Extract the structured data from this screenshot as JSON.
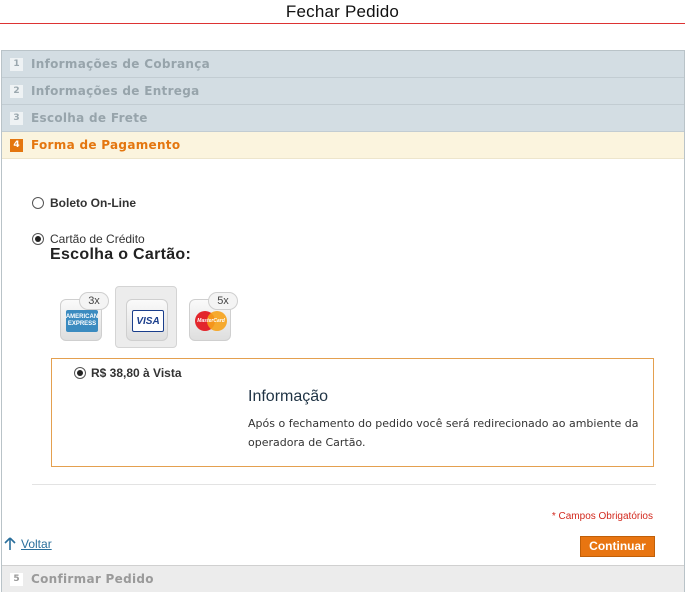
{
  "header": {
    "title": "Fechar Pedido"
  },
  "steps": [
    {
      "num": "1",
      "label": "Informações de Cobrança"
    },
    {
      "num": "2",
      "label": "Informações de Entrega"
    },
    {
      "num": "3",
      "label": "Escolha de Frete"
    },
    {
      "num": "4",
      "label": "Forma de Pagamento"
    },
    {
      "num": "5",
      "label": "Confirmar Pedido"
    }
  ],
  "payment": {
    "options": [
      {
        "label": "Boleto On-Line",
        "selected": false
      },
      {
        "label": "Cartão de Crédito",
        "selected": true
      }
    ],
    "choose_card_title": "Escolha o Cartão:",
    "cards": [
      {
        "name": "amex-card-icon",
        "logo_text": "AMERICAN EXPRESS",
        "installments_badge": "3x",
        "selected": false
      },
      {
        "name": "visa-card-icon",
        "logo_text": "VISA",
        "installments_badge": "",
        "selected": true
      },
      {
        "name": "mastercard-card-icon",
        "logo_text": "MasterCard",
        "installments_badge": "5x",
        "selected": false
      }
    ],
    "installment_option": {
      "label": "R$ 38,80 à Vista",
      "selected": true
    },
    "info": {
      "title": "Informação",
      "text": "Após o fechamento do pedido você será redirecionado ao ambiente da operadora de Cartão."
    },
    "required_note": "* Campos Obrigatórios",
    "back_label": "Voltar",
    "continue_label": "Continuar"
  },
  "colors": {
    "accent": "#e87511",
    "header_rule": "#dd3333",
    "step_inactive_bg": "#d3dde3",
    "step_active_bg": "#fbf4de",
    "link": "#2a6f9c"
  }
}
